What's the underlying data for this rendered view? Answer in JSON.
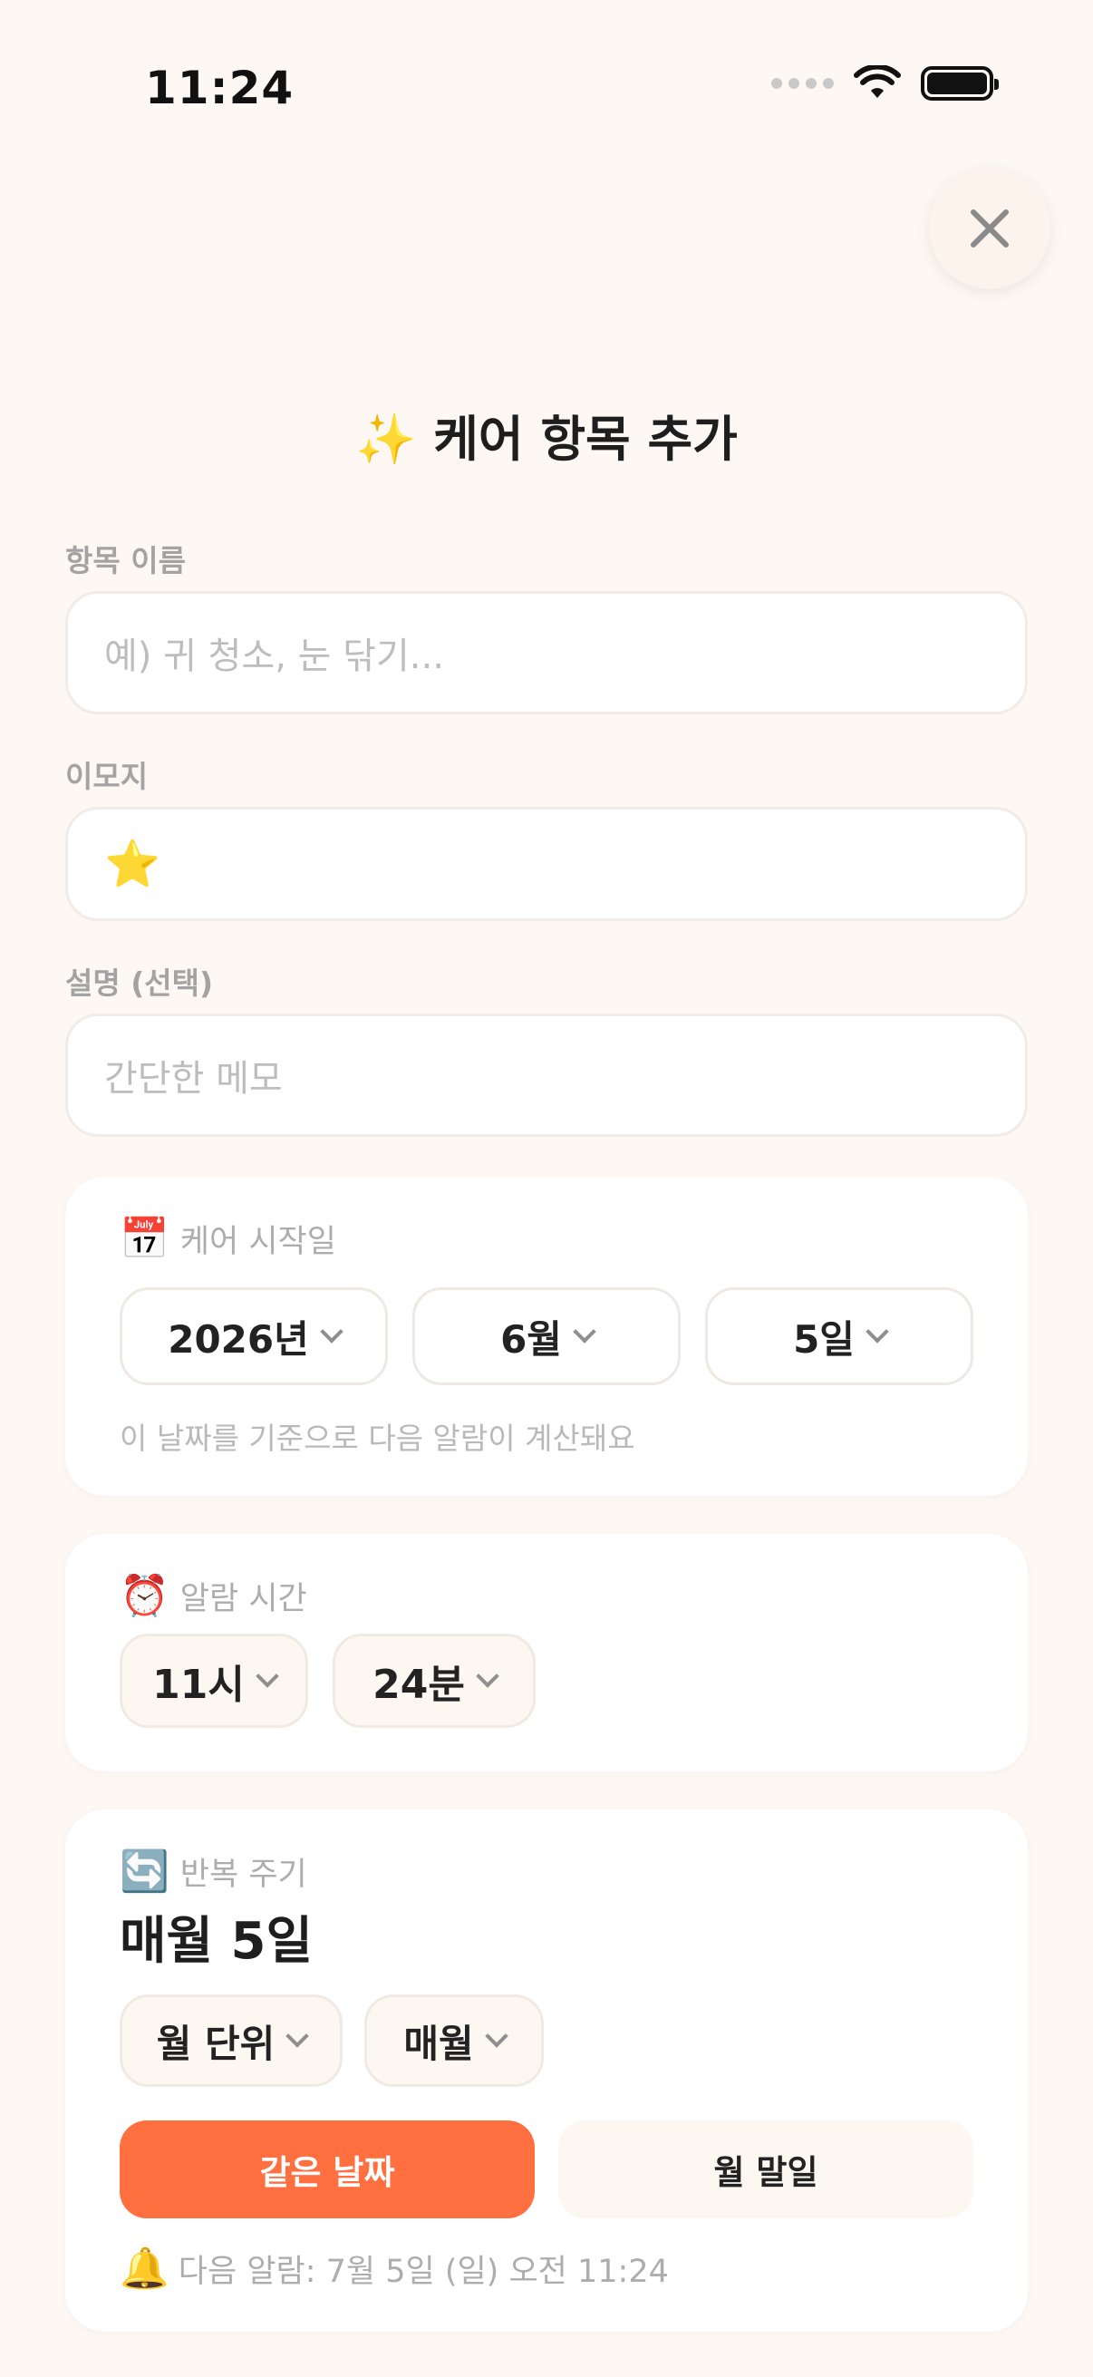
{
  "status_bar": {
    "time": "11:24"
  },
  "header": {
    "title_emoji": "✨",
    "title": "케어 항목 추가"
  },
  "form": {
    "name_label": "항목 이름",
    "name_placeholder": "예) 귀 청소, 눈 닦기...",
    "emoji_label": "이모지",
    "emoji_value": "⭐",
    "desc_label": "설명 (선택)",
    "desc_placeholder": "간단한 메모"
  },
  "start_date": {
    "icon": "📅",
    "label": "케어 시작일",
    "year": "2026년",
    "month": "6월",
    "day": "5일",
    "hint": "이 날짜를 기준으로 다음 알람이 계산돼요"
  },
  "alarm_time": {
    "icon": "⏰",
    "label": "알람 시간",
    "hour": "11시",
    "minute": "24분"
  },
  "repeat": {
    "icon": "🔄",
    "label": "반복 주기",
    "summary": "매월 5일",
    "unit": "월 단위",
    "interval": "매월",
    "option_same_day": "같은 날짜",
    "option_month_end": "월 말일",
    "selected_option": "같은 날짜",
    "next_alarm_icon": "🔔",
    "next_alarm": "다음 알람: 7월 5일 (일) 오전 11:24"
  },
  "colors": {
    "accent": "#FF6F40",
    "background": "#FDF8F4",
    "card": "#FFFFFF",
    "muted": "#ADADAD"
  }
}
